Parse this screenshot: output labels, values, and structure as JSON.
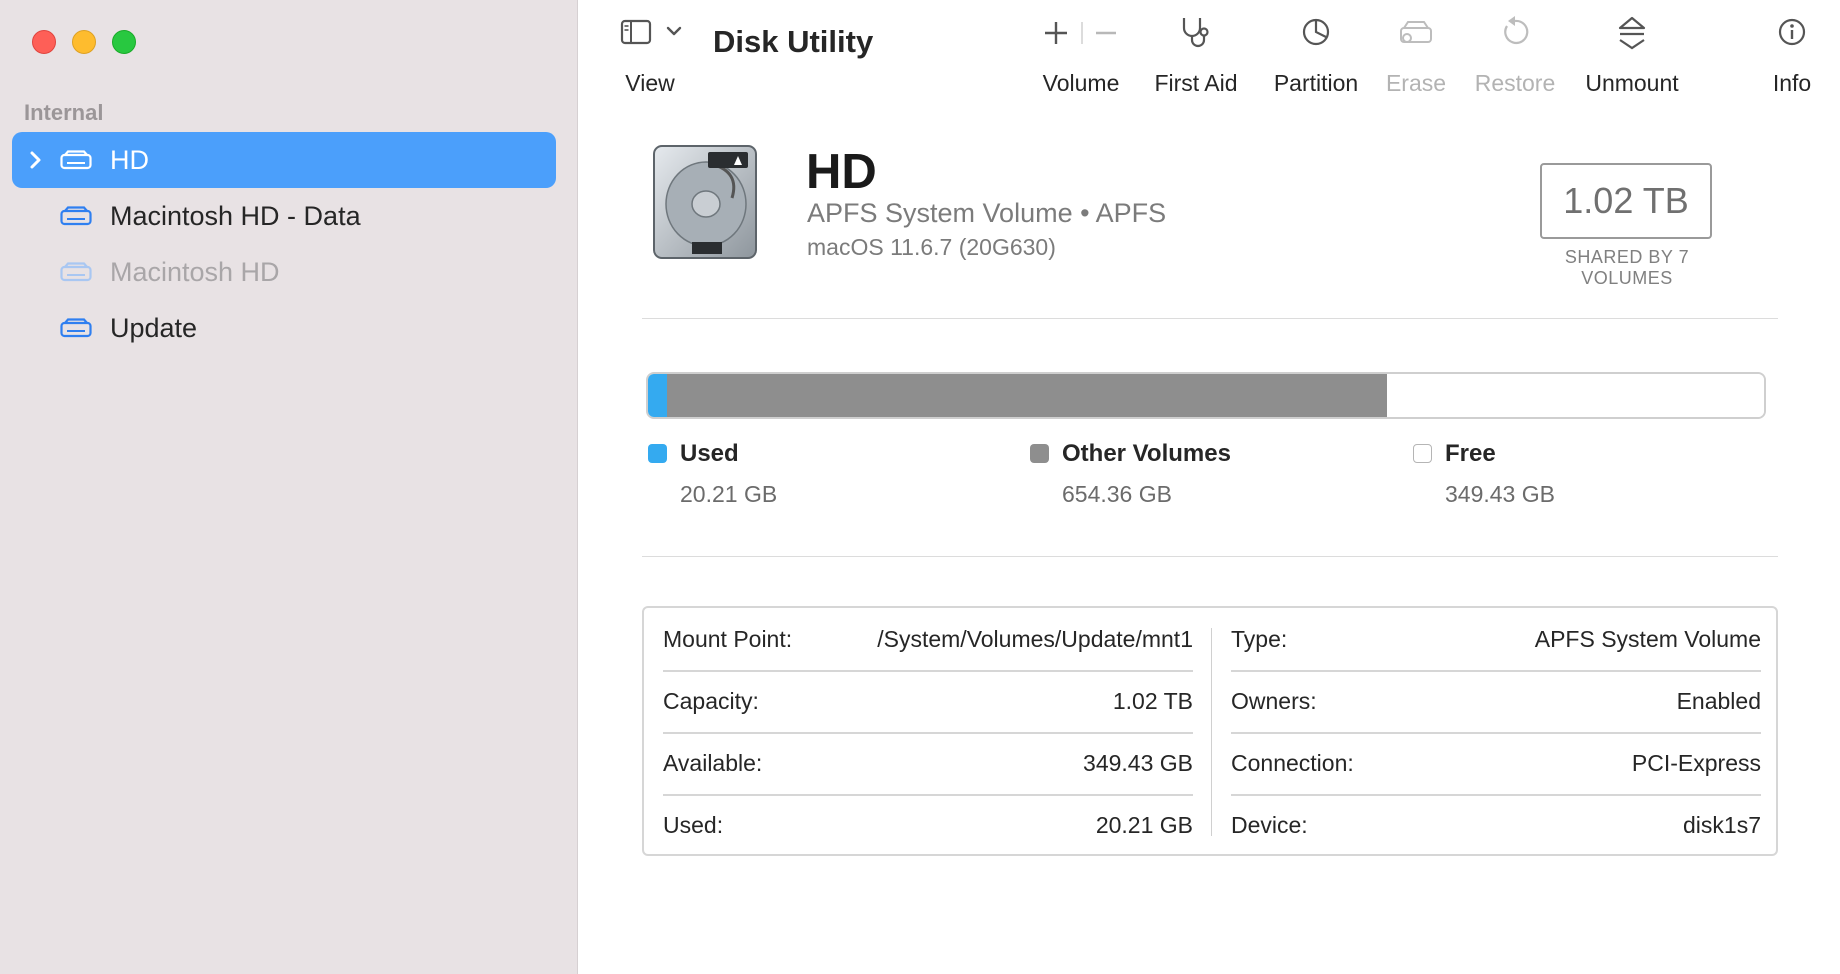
{
  "window": {
    "title": "Disk Utility"
  },
  "sidebar": {
    "section": "Internal",
    "items": [
      {
        "label": "HD",
        "selected": true
      },
      {
        "label": "Macintosh HD - Data",
        "selected": false
      },
      {
        "label": "Macintosh HD",
        "selected": false
      },
      {
        "label": "Update",
        "selected": false
      }
    ]
  },
  "toolbar": {
    "view": "View",
    "volume": "Volume",
    "first_aid": "First Aid",
    "partition": "Partition",
    "erase": "Erase",
    "restore": "Restore",
    "unmount": "Unmount",
    "info": "Info"
  },
  "volume": {
    "name": "HD",
    "subtitle": "APFS System Volume • APFS",
    "os": "macOS 11.6.7 (20G630)",
    "size": "1.02 TB",
    "shared": "SHARED BY 7 VOLUMES"
  },
  "usage": {
    "legend": [
      {
        "name": "Used",
        "value": "20.21 GB",
        "color": "#34aaf0"
      },
      {
        "name": "Other Volumes",
        "value": "654.36 GB",
        "color": "#8e8e8e"
      },
      {
        "name": "Free",
        "value": "349.43 GB",
        "color": "#ffffff"
      }
    ]
  },
  "details": {
    "left": [
      {
        "key": "Mount Point:",
        "value": "/System/Volumes/Update/mnt1"
      },
      {
        "key": "Capacity:",
        "value": "1.02 TB"
      },
      {
        "key": "Available:",
        "value": "349.43 GB"
      },
      {
        "key": "Used:",
        "value": "20.21 GB"
      }
    ],
    "right": [
      {
        "key": "Type:",
        "value": "APFS System Volume"
      },
      {
        "key": "Owners:",
        "value": "Enabled"
      },
      {
        "key": "Connection:",
        "value": "PCI-Express"
      },
      {
        "key": "Device:",
        "value": "disk1s7"
      }
    ]
  }
}
